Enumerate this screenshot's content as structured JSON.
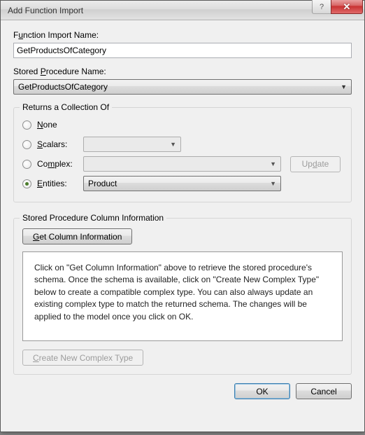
{
  "window": {
    "title": "Add Function Import"
  },
  "fields": {
    "functionImportName": {
      "label_pre": "F",
      "label_u": "u",
      "label_post": "nction Import Name:",
      "value": "GetProductsOfCategory"
    },
    "storedProcedureName": {
      "label_pre": "Stored ",
      "label_u": "P",
      "label_post": "rocedure Name:",
      "value": "GetProductsOfCategory"
    }
  },
  "returns": {
    "legend": "Returns a Collection Of",
    "options": {
      "none": {
        "pre": "",
        "u": "N",
        "post": "one",
        "checked": false
      },
      "scalars": {
        "pre": "",
        "u": "S",
        "post": "calars:",
        "checked": false,
        "combo": ""
      },
      "complex": {
        "pre": "Co",
        "u": "m",
        "post": "plex:",
        "checked": false,
        "combo": ""
      },
      "entities": {
        "pre": "",
        "u": "E",
        "post": "ntities:",
        "checked": true,
        "combo": "Product"
      }
    },
    "update_btn": {
      "pre": "Up",
      "u": "d",
      "post": "ate"
    }
  },
  "spci": {
    "legend": "Stored Procedure Column Information",
    "getColumns_btn": {
      "pre": "",
      "u": "G",
      "post": "et Column Information"
    },
    "info_text": "Click on \"Get Column Information\" above to retrieve the stored procedure's schema. Once the schema is available, click on \"Create New Complex Type\" below to create a compatible complex type. You can also always update an existing complex type to match the returned schema. The changes will be applied to the model once you click on OK.",
    "createComplex_btn": {
      "pre": "",
      "u": "C",
      "post": "reate New Complex Type"
    }
  },
  "footer": {
    "ok": "OK",
    "cancel": "Cancel"
  }
}
